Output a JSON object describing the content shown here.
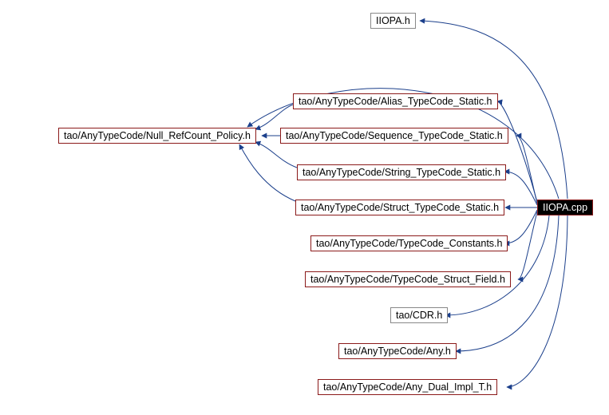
{
  "source_node": {
    "label": "IIOPA.cpp"
  },
  "nodes": {
    "iiopa_h": {
      "label": "IIOPA.h"
    },
    "null_refcnt": {
      "label": "tao/AnyTypeCode/Null_RefCount_Policy.h"
    },
    "alias_tc": {
      "label": "tao/AnyTypeCode/Alias_TypeCode_Static.h"
    },
    "sequence_tc": {
      "label": "tao/AnyTypeCode/Sequence_TypeCode_Static.h"
    },
    "string_tc": {
      "label": "tao/AnyTypeCode/String_TypeCode_Static.h"
    },
    "struct_tc": {
      "label": "tao/AnyTypeCode/Struct_TypeCode_Static.h"
    },
    "tc_const": {
      "label": "tao/AnyTypeCode/TypeCode_Constants.h"
    },
    "tc_struct_field": {
      "label": "tao/AnyTypeCode/TypeCode_Struct_Field.h"
    },
    "cdr_h": {
      "label": "tao/CDR.h"
    },
    "any_h": {
      "label": "tao/AnyTypeCode/Any.h"
    },
    "any_dual": {
      "label": "tao/AnyTypeCode/Any_Dual_Impl_T.h"
    }
  }
}
